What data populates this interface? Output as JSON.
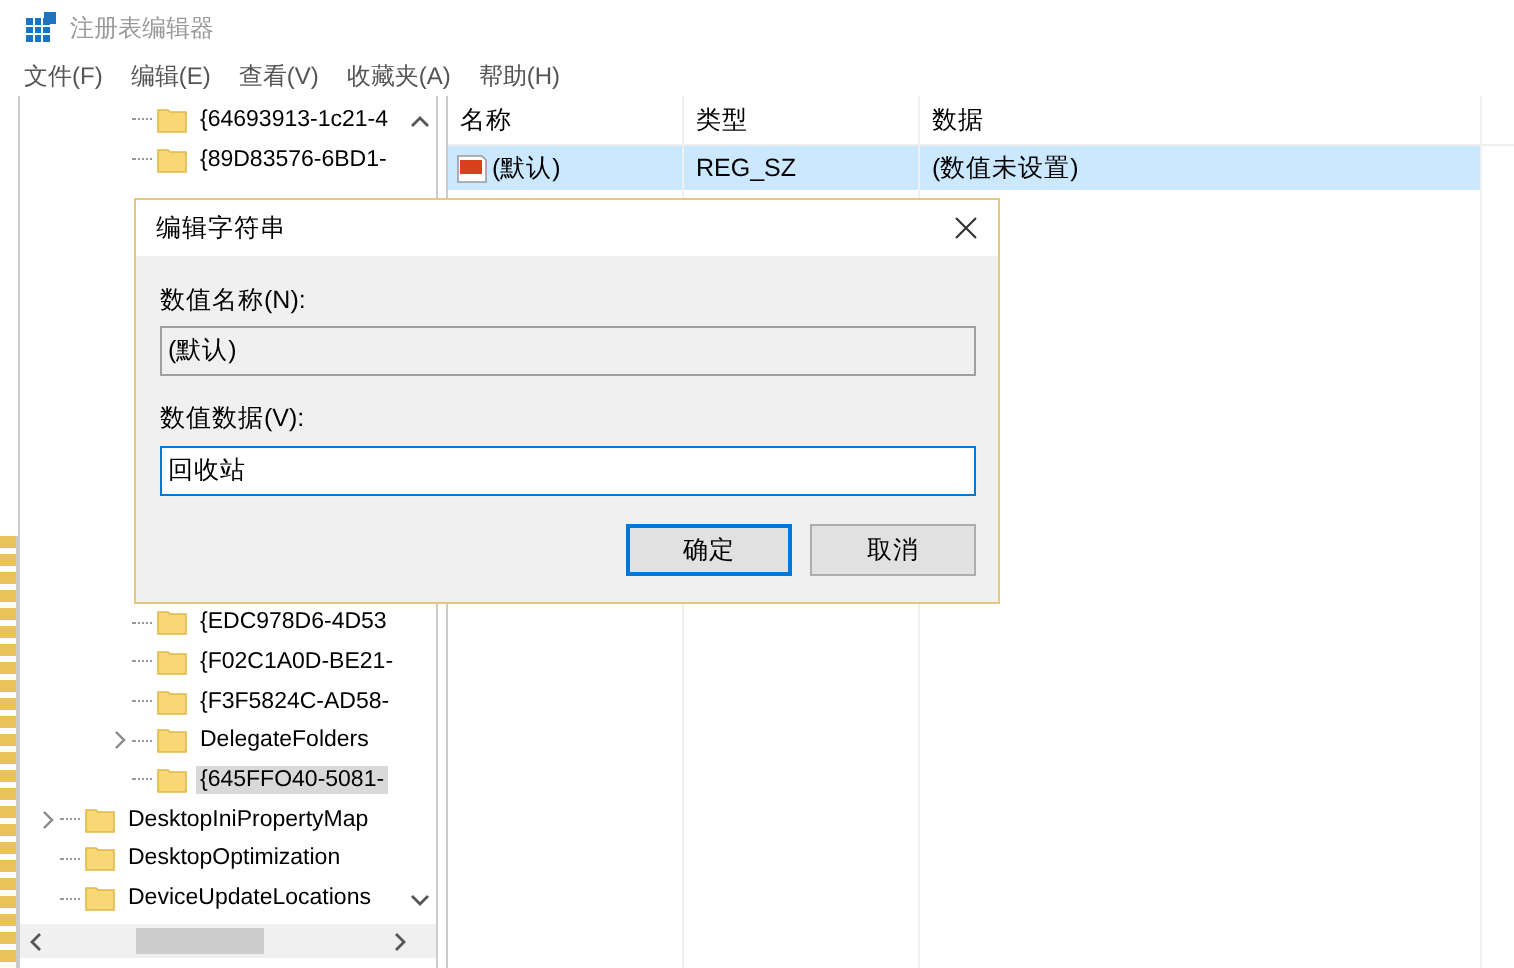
{
  "window": {
    "title": "注册表编辑器"
  },
  "menu": [
    "文件(F)",
    "编辑(E)",
    "查看(V)",
    "收藏夹(A)",
    "帮助(H)"
  ],
  "tree": {
    "items": [
      {
        "children": [
          {
            "label": "{64693913-1c21-4",
            "expandable": false,
            "selected": false
          },
          {
            "label": "{89D83576-6BD1-",
            "expandable": false,
            "selected": false
          },
          {
            "label": "{EDC978D6-4D53",
            "expandable": false,
            "selected": false
          },
          {
            "label": "{F02C1A0D-BE21-",
            "expandable": false,
            "selected": false
          },
          {
            "label": "{F3F5824C-AD58-",
            "expandable": false,
            "selected": false
          },
          {
            "label": "DelegateFolders",
            "expandable": true,
            "selected": false
          },
          {
            "label": "{645FFO40-5081-",
            "expandable": false,
            "selected": true
          }
        ]
      },
      {
        "label": "DesktopIniPropertyMap",
        "expandable": true,
        "selected": false
      },
      {
        "label": "DesktopOptimization",
        "expandable": false,
        "selected": false
      },
      {
        "label": "DeviceUpdateLocations",
        "expandable": false,
        "selected": false
      }
    ]
  },
  "list": {
    "columns": [
      "名称",
      "类型",
      "数据"
    ],
    "rows": [
      {
        "name": "(默认)",
        "type": "REG_SZ",
        "data": "(数值未设置)",
        "selected": true
      }
    ]
  },
  "dialog": {
    "title": "编辑字符串",
    "name_label": "数值名称(N):",
    "name_value": "(默认)",
    "data_label": "数值数据(V):",
    "data_value": "回收站",
    "buttons": [
      {
        "label": "确定",
        "default": true
      },
      {
        "label": "取消",
        "default": false
      }
    ]
  }
}
